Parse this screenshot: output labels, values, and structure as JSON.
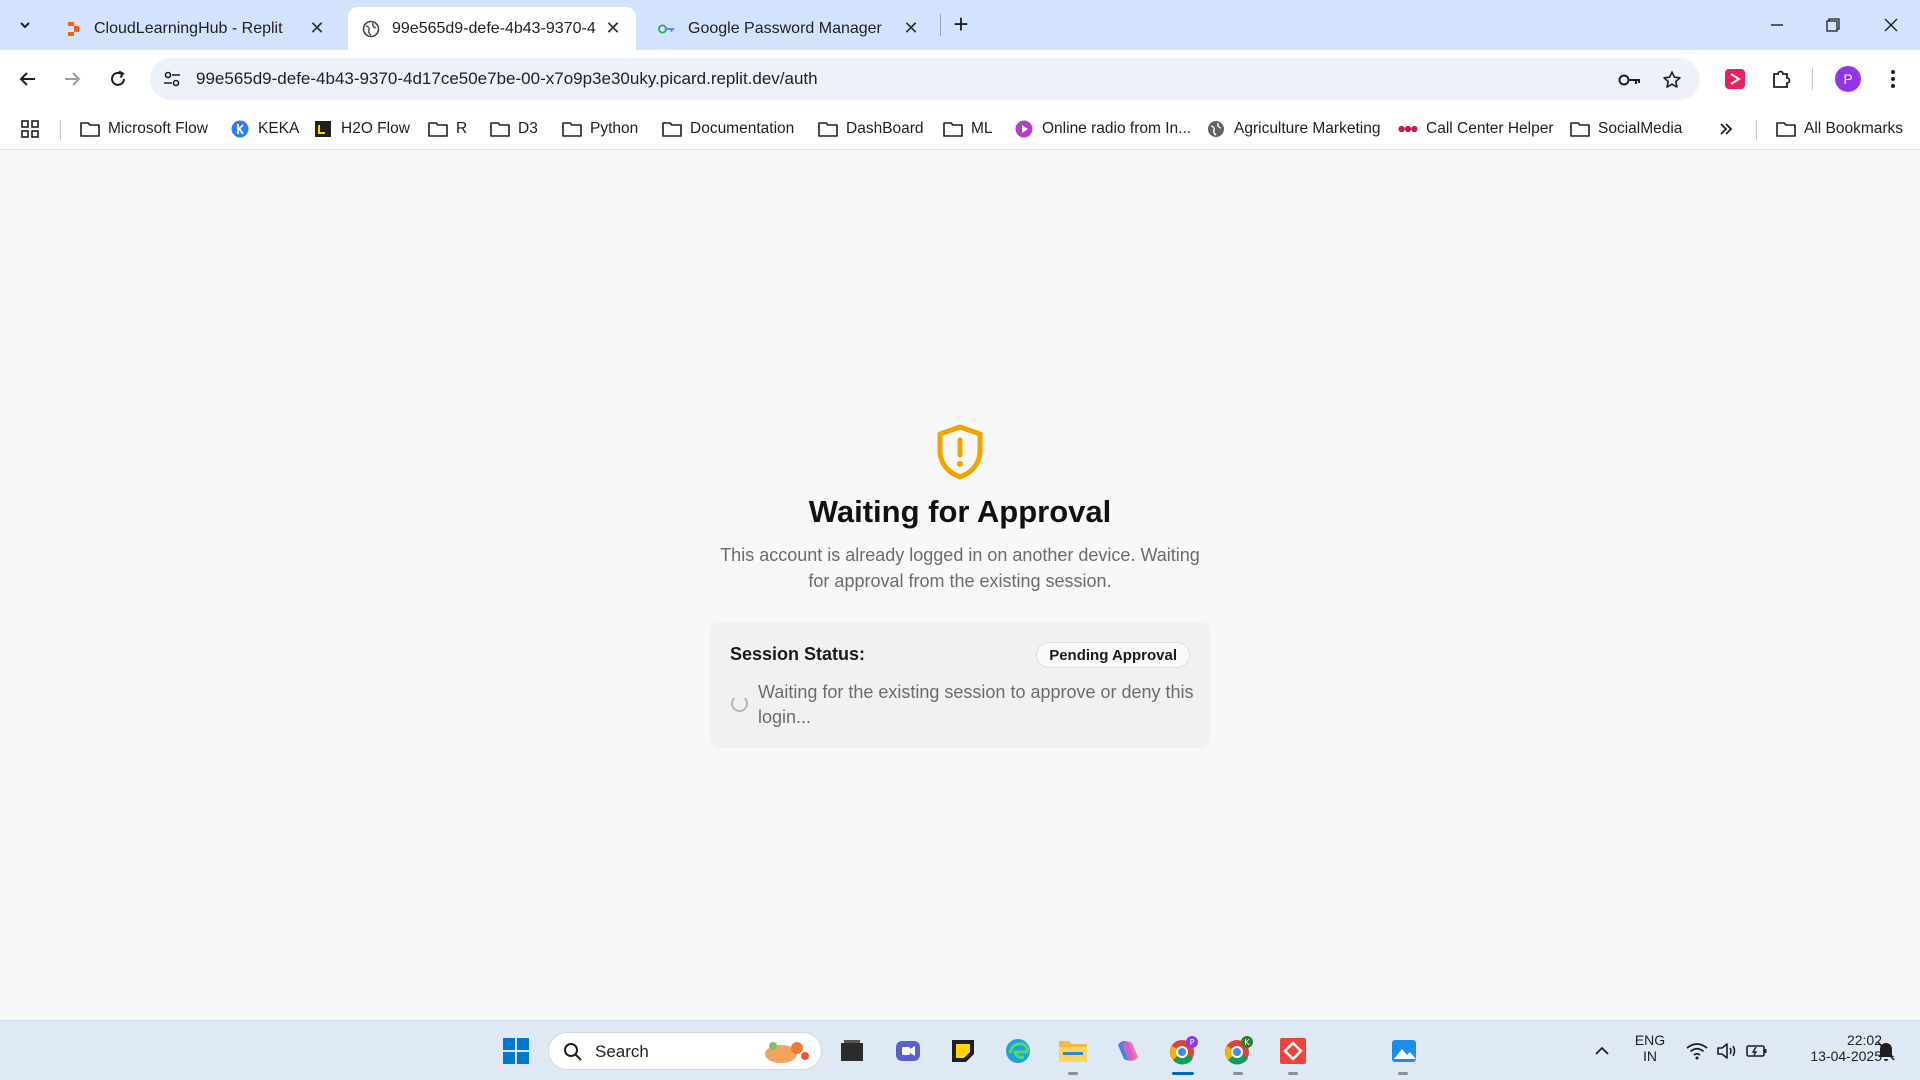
{
  "browser": {
    "tabs": [
      {
        "title": "CloudLearningHub - Replit",
        "favicon": "replit-icon",
        "active": false
      },
      {
        "title": "99e565d9-defe-4b43-9370-4d17ce50e7be-00-x7o9p3e30uky.picard.replit.dev/auth",
        "favicon": "globe-icon",
        "active": true
      },
      {
        "title": "Google Password Manager",
        "favicon": "key-icon",
        "active": false
      }
    ],
    "url": "99e565d9-defe-4b43-9370-4d17ce50e7be-00-x7o9p3e30uky.picard.replit.dev/auth",
    "profile_initial": "P"
  },
  "bookmarks": [
    {
      "label": "Microsoft Flow",
      "icon": "folder-icon"
    },
    {
      "label": "KEKA",
      "icon": "keka-icon"
    },
    {
      "label": "H2O Flow",
      "icon": "h2o-icon"
    },
    {
      "label": "R",
      "icon": "folder-icon"
    },
    {
      "label": "D3",
      "icon": "folder-icon"
    },
    {
      "label": "Python",
      "icon": "folder-icon"
    },
    {
      "label": "Documentation",
      "icon": "folder-icon"
    },
    {
      "label": "DashBoard",
      "icon": "folder-icon"
    },
    {
      "label": "ML",
      "icon": "folder-icon"
    },
    {
      "label": "Online radio from In...",
      "icon": "radio-icon"
    },
    {
      "label": "Agriculture Marketing",
      "icon": "globe-icon"
    },
    {
      "label": "Call Center Helper",
      "icon": "dots-icon"
    },
    {
      "label": "SocialMedia",
      "icon": "folder-icon"
    }
  ],
  "all_bookmarks_label": "All Bookmarks",
  "page": {
    "heading": "Waiting for Approval",
    "description": "This account is already logged in on another device. Waiting for approval from the existing session.",
    "status_label": "Session Status:",
    "status_badge": "Pending Approval",
    "status_message": "Waiting for the existing session to approve or deny this login...",
    "accent_color": "#f0a500"
  },
  "taskbar": {
    "search_label": "Search",
    "language": "ENG",
    "region": "IN",
    "time": "22:02",
    "date": "13-04-2025"
  }
}
